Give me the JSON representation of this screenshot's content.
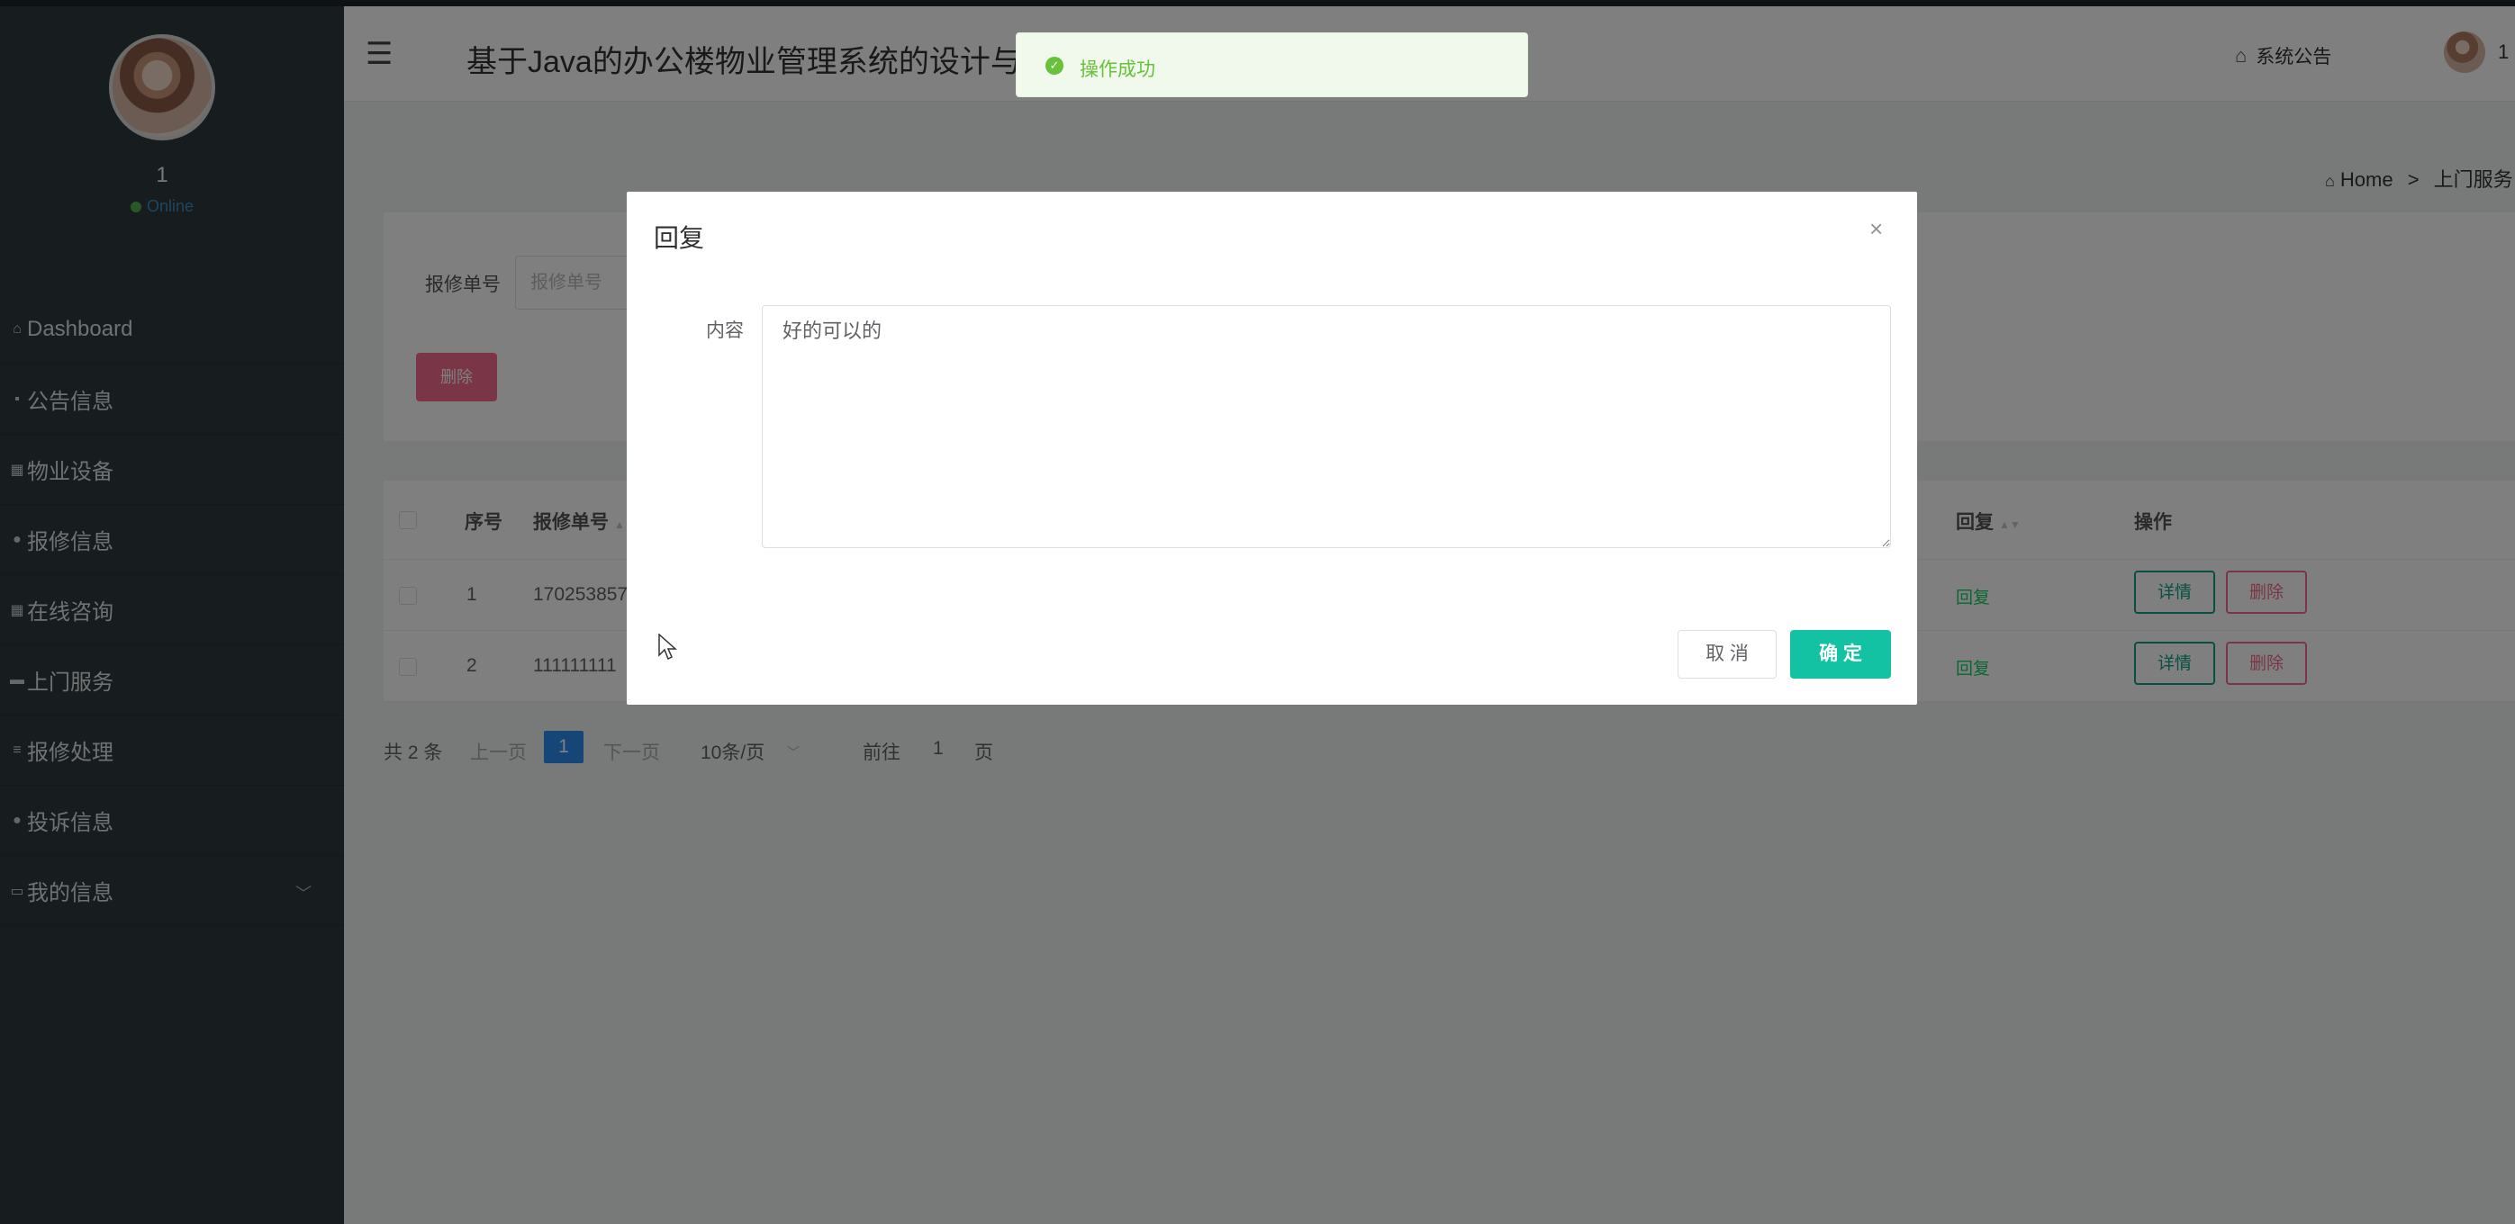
{
  "sidebar": {
    "user_name": "1",
    "status": "Online",
    "items": [
      {
        "label": "Dashboard",
        "icon": "home-icon"
      },
      {
        "label": "公告信息",
        "icon": "message-icon"
      },
      {
        "label": "物业设备",
        "icon": "grid-icon"
      },
      {
        "label": "报修信息",
        "icon": "pin-icon"
      },
      {
        "label": "在线咨询",
        "icon": "grid-icon"
      },
      {
        "label": "上门服务",
        "icon": "ticket-icon"
      },
      {
        "label": "报修处理",
        "icon": "list-icon"
      },
      {
        "label": "投诉信息",
        "icon": "pin-icon"
      },
      {
        "label": "我的信息",
        "icon": "card-icon"
      }
    ]
  },
  "header": {
    "title": "基于Java的办公楼物业管理系统的设计与实",
    "announcement": "系统公告",
    "user": "1"
  },
  "breadcrumb": {
    "home": "Home",
    "sep": ">",
    "current": "上门服务"
  },
  "filter": {
    "label": "报修单号",
    "placeholder": "报修单号",
    "delete_label": "删除"
  },
  "table": {
    "headers": {
      "index": "序号",
      "order_no": "报修单号",
      "reply": "回复",
      "actions": "操作"
    },
    "rows": [
      {
        "index": "1",
        "order_no": "170253857",
        "reply": "回复",
        "detail": "详情",
        "delete": "删除"
      },
      {
        "index": "2",
        "order_no": "111111111",
        "reply": "回复",
        "detail": "详情",
        "delete": "删除"
      }
    ]
  },
  "pager": {
    "total": "共 2 条",
    "prev": "上一页",
    "current_page": "1",
    "next": "下一页",
    "page_size": "10条/页",
    "goto_prefix": "前往",
    "goto_value": "1",
    "goto_suffix": "页"
  },
  "dialog": {
    "title": "回复",
    "close": "×",
    "content_label": "内容",
    "content_value": "好的可以的",
    "cancel": "取 消",
    "confirm": "确 定"
  },
  "toast": {
    "message": "操作成功"
  },
  "colors": {
    "sidebar_bg": "#2f383d",
    "accent_teal": "#13c2a3",
    "danger_pink": "#f56c8c",
    "success_green": "#67c23a",
    "page_blue": "#2d8cf0"
  }
}
